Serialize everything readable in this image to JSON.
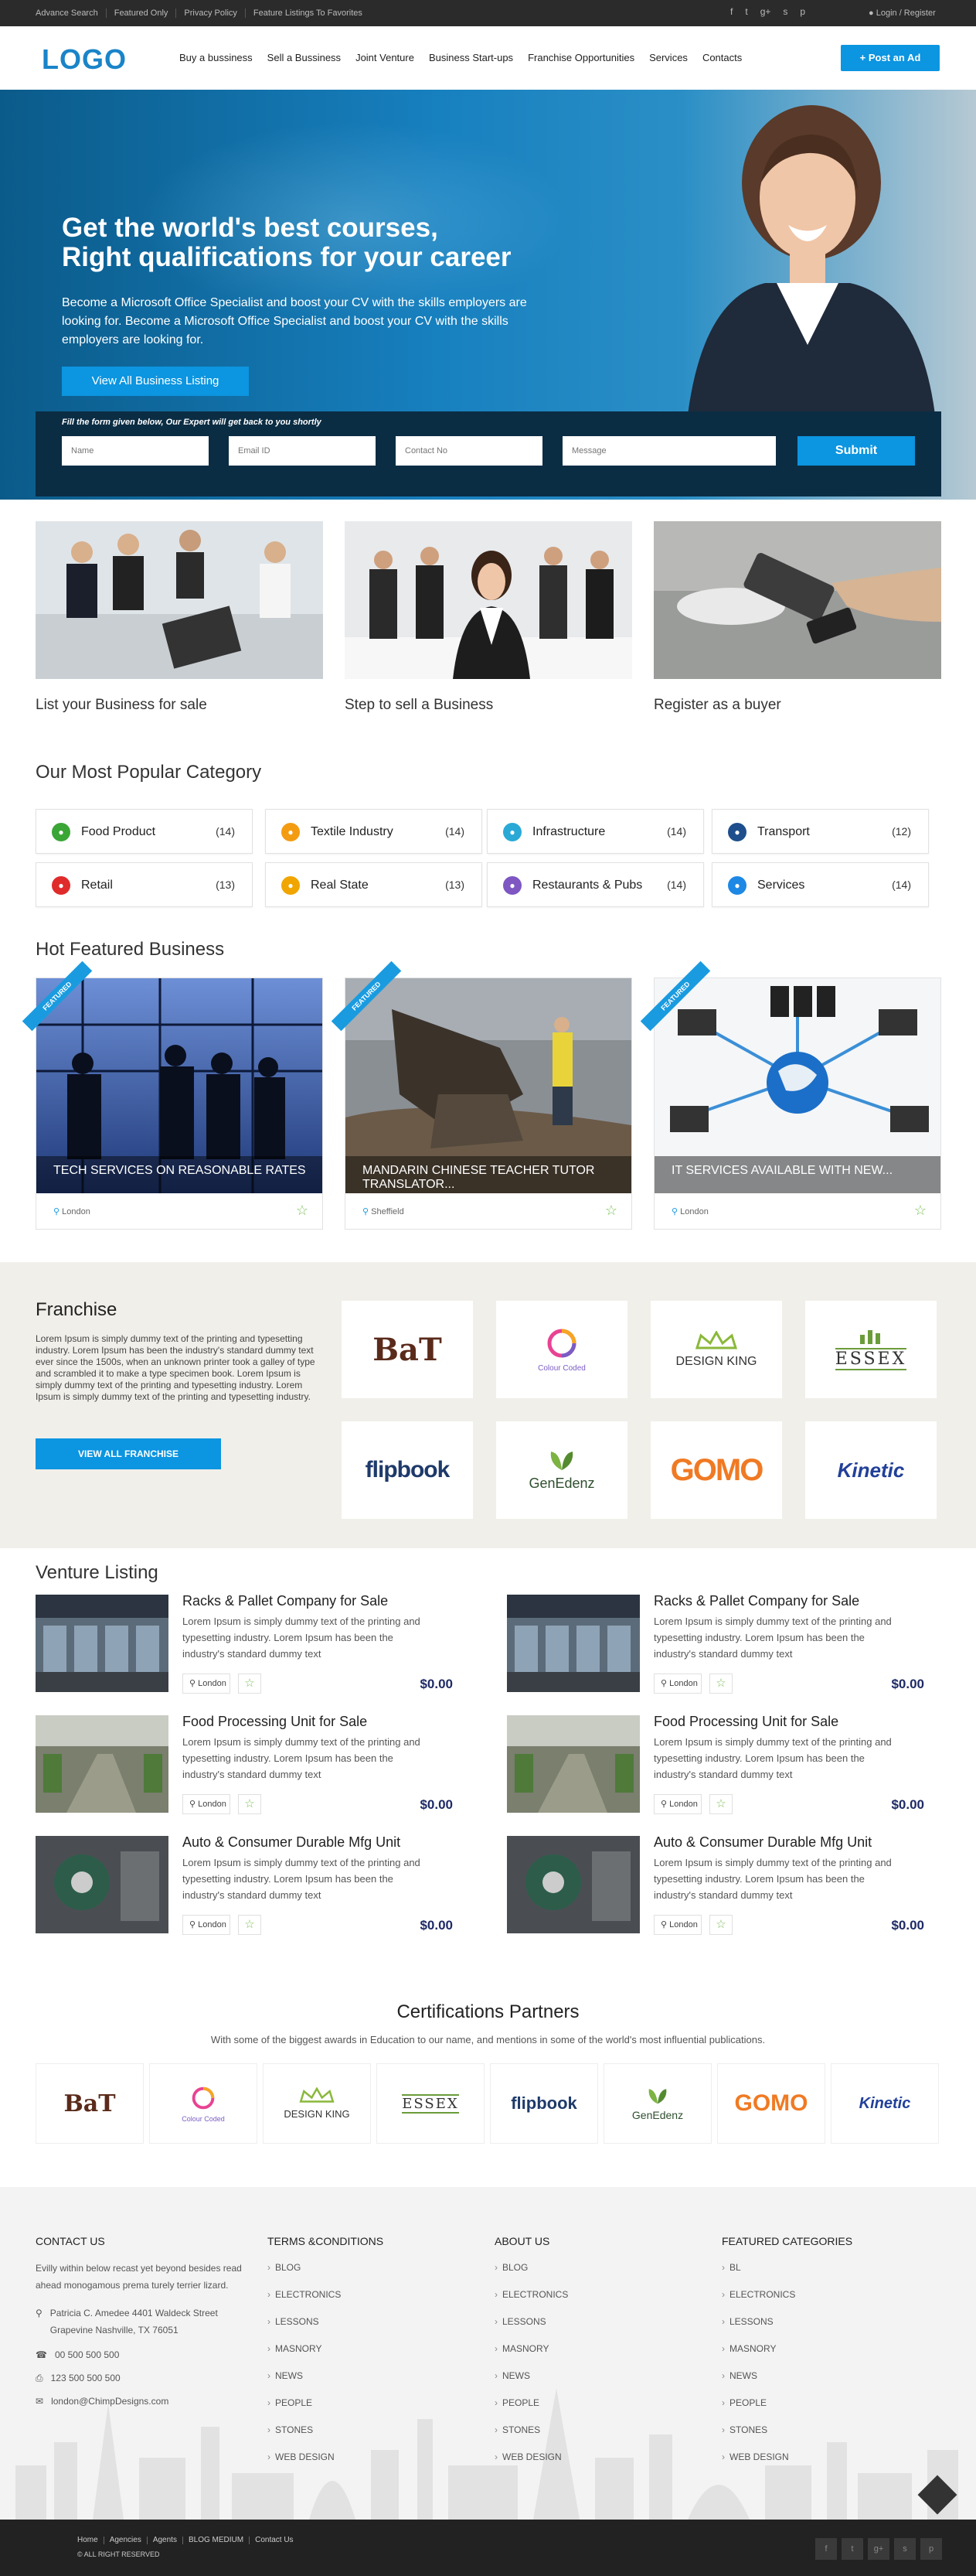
{
  "topbar": {
    "links": [
      "Advance Search",
      "Featured Only",
      "Privacy Policy",
      "Feature Listings To Favorites"
    ],
    "login": "Login / Register"
  },
  "header": {
    "logo": "LOGO",
    "nav": [
      "Buy a bussiness",
      "Sell  a Bussiness",
      "Joint Venture",
      "Business Start-ups",
      "Franchise Opportunities",
      "Services",
      "Contacts"
    ],
    "post_ad": "Post an Ad"
  },
  "hero": {
    "title_line1": "Get the world's best courses,",
    "title_line2": "Right qualifications for your career",
    "description": "Become a Microsoft Office Specialist and boost your CV with the skills employers are looking for. Become a Microsoft Office Specialist and boost your CV with the skills employers are looking for.",
    "button": "View All Business Listing",
    "form_label": "Fill the form given below, Our Expert will get back to you shortly",
    "placeholders": {
      "name": "Name",
      "email": "Email ID",
      "contact": "Contact No",
      "message": "Message"
    },
    "submit": "Submit"
  },
  "features": [
    {
      "caption": "List your Business for sale"
    },
    {
      "caption": "Step to sell a Business"
    },
    {
      "caption": "Register as a buyer"
    }
  ],
  "categories_title": "Our Most Popular Category",
  "categories": [
    {
      "name": "Food Product",
      "count": "(14)",
      "color": "#3aa635"
    },
    {
      "name": "Textile Industry",
      "count": "(14)",
      "color": "#f39c12"
    },
    {
      "name": "Infrastructure",
      "count": "(14)",
      "color": "#2aa9d6"
    },
    {
      "name": "Transport",
      "count": "(12)",
      "color": "#1e4f8c"
    },
    {
      "name": "Retail",
      "count": "(13)",
      "color": "#e02b2b"
    },
    {
      "name": "Real State",
      "count": "(13)",
      "color": "#f0a500"
    },
    {
      "name": "Restaurants  & Pubs",
      "count": "(14)",
      "color": "#7e57c2"
    },
    {
      "name": "Services",
      "count": "(14)",
      "color": "#1e88e5"
    }
  ],
  "hot_title": "Hot Featured Business",
  "hot": [
    {
      "badge": "FEATURED",
      "title": "TECH SERVICES ON REASONABLE RATES",
      "location": "London"
    },
    {
      "badge": "FEATURED",
      "title": "MANDARIN CHINESE TEACHER TUTOR TRANSLATOR...",
      "location": "Sheffield"
    },
    {
      "badge": "FEATURED",
      "title": "IT SERVICES AVAILABLE WITH NEW...",
      "location": "London"
    }
  ],
  "franchise": {
    "title": "Franchise",
    "text": "Lorem Ipsum is simply dummy text of the printing and typesetting industry. Lorem Ipsum has been the industry's standard dummy text ever since the 1500s, when an unknown printer took a galley of type and scrambled it to make a type specimen book. Lorem Ipsum is simply dummy text of the printing and typesetting industry. Lorem Ipsum is simply dummy text of the printing and typesetting industry.",
    "button": "VIEW ALL FRANCHISE",
    "logos": [
      "BaT",
      "Colour Coded",
      "DESIGN KING",
      "ESSEX",
      "flipbook",
      "GenEdenz",
      "GOMO",
      "Kinetic"
    ]
  },
  "venture_title": "Venture Listing",
  "ventures": [
    {
      "title": "Racks & Pallet Company for Sale",
      "desc": "Lorem Ipsum is simply dummy text of the printing and typesetting industry. Lorem Ipsum has been the industry's standard dummy text",
      "location": "London",
      "price": "$0.00"
    },
    {
      "title": "Racks & Pallet Company for Sale",
      "desc": "Lorem Ipsum is simply dummy text of the printing and typesetting industry. Lorem Ipsum has been the industry's standard dummy text",
      "location": "London",
      "price": "$0.00"
    },
    {
      "title": "Food Processing Unit for Sale",
      "desc": "Lorem Ipsum is simply dummy text of the printing and typesetting industry. Lorem Ipsum has been the industry's standard dummy text",
      "location": "London",
      "price": "$0.00"
    },
    {
      "title": "Food Processing Unit for Sale",
      "desc": "Lorem Ipsum is simply dummy text of the printing and typesetting industry. Lorem Ipsum has been the industry's standard dummy text",
      "location": "London",
      "price": "$0.00"
    },
    {
      "title": "Auto & Consumer Durable Mfg Unit",
      "desc": "Lorem Ipsum is simply dummy text of the printing and typesetting industry. Lorem Ipsum has been the industry's standard dummy text",
      "location": "London",
      "price": "$0.00"
    },
    {
      "title": "Auto & Consumer Durable Mfg Unit",
      "desc": "Lorem Ipsum is simply dummy text of the printing and typesetting industry. Lorem Ipsum has been the industry's standard dummy text",
      "location": "London",
      "price": "$0.00"
    }
  ],
  "certifications": {
    "title": "Certifications Partners",
    "subtitle": "With some of the biggest awards in Education to our name, and mentions in some of the world's most influential publications."
  },
  "footer": {
    "contact_title": "CONTACT US",
    "contact_text": "Evilly within below recast yet beyond besides read ahead monogamous prema turely terrier lizard.",
    "address": "Patricia C. Amedee 4401 Waldeck Street Grapevine Nashville, TX 76051",
    "phone": "00 500 500 500",
    "fax": "123 500 500 500",
    "email": "london@ChimpDesigns.com",
    "columns": [
      {
        "title": "TERMS &CONDITIONS",
        "items": [
          "BLOG",
          "ELECTRONICS",
          "LESSONS",
          "MASNORY",
          "NEWS",
          "PEOPLE",
          "STONES",
          "WEB DESIGN"
        ]
      },
      {
        "title": "ABOUT US",
        "items": [
          "BLOG",
          "ELECTRONICS",
          "LESSONS",
          "MASNORY",
          "NEWS",
          "PEOPLE",
          "STONES",
          "WEB DESIGN"
        ]
      },
      {
        "title": "FEATURED CATEGORIES",
        "items": [
          "BL",
          "ELECTRONICS",
          "LESSONS",
          "MASNORY",
          "NEWS",
          "PEOPLE",
          "STONES",
          "WEB DESIGN"
        ]
      }
    ]
  },
  "bottombar": {
    "links": [
      "Home",
      "Agencies",
      "Agents",
      "BLOG MEDIUM",
      "Contact Us"
    ],
    "rights": "© ALL RIGHT RESERVED"
  },
  "colors": {
    "accent": "#0c95e0",
    "dark": "#222222",
    "price": "#1e2a66",
    "star": "#7ec15a"
  }
}
